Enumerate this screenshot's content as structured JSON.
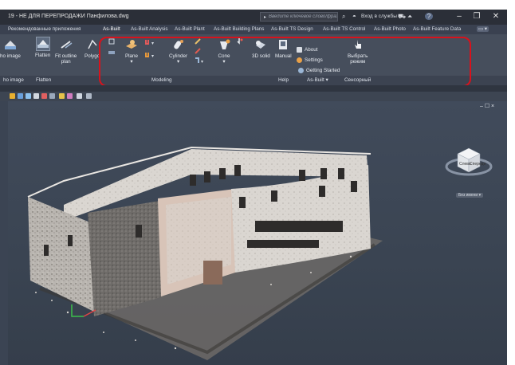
{
  "window": {
    "title": "19 - НЕ ДЛЯ ПЕРЕПРОДАЖИ   Панфилова.dwg",
    "search_placeholder": "Введите ключевое слово/фразу",
    "signin_label": "Вход в службы",
    "help_icon": "question-icon"
  },
  "tabs": [
    {
      "label": "Рекомендованные приложения"
    },
    {
      "label": "As-Built",
      "active": true
    },
    {
      "label": "As-Built Analysis"
    },
    {
      "label": "As-Built Plant"
    },
    {
      "label": "As-Built Building Plans"
    },
    {
      "label": "As-Built TS Design"
    },
    {
      "label": "As-Built TS Control"
    },
    {
      "label": "As-Built Photo"
    },
    {
      "label": "As-Built Feature Data"
    }
  ],
  "ribbon": {
    "buttons": {
      "ortho_image": "ho image",
      "flatten": "Flatten",
      "fit_outline_1": "Fit outline",
      "fit_outline_2": "plan",
      "polygon": "Polygo",
      "plane": "Plane",
      "cylinder": "Cylinder",
      "cone": "Cone",
      "solid_3d": "3D solid",
      "manual": "Manual",
      "select_mode_1": "Выбрать",
      "select_mode_2": "режим"
    },
    "help_items": {
      "about": "About",
      "settings": "Settings",
      "getting_started": "Getting Started"
    },
    "panels": {
      "ortho_image": "ho image",
      "flatten": "Flatten",
      "modeling": "Modeling",
      "help": "Help",
      "as_built": "As-Built",
      "touch": "Сенсорный"
    }
  },
  "viewport": {
    "controls": "– ☐ ×",
    "viewcube_left": "Слева",
    "viewcube_right": "Спереди",
    "view_label": "Без имени"
  },
  "colors": {
    "highlight_outline": "#d8121c",
    "title_bg": "#2b2f38",
    "ribbon_bg": "#464e5c",
    "viewport_bg": "#3a4452"
  }
}
